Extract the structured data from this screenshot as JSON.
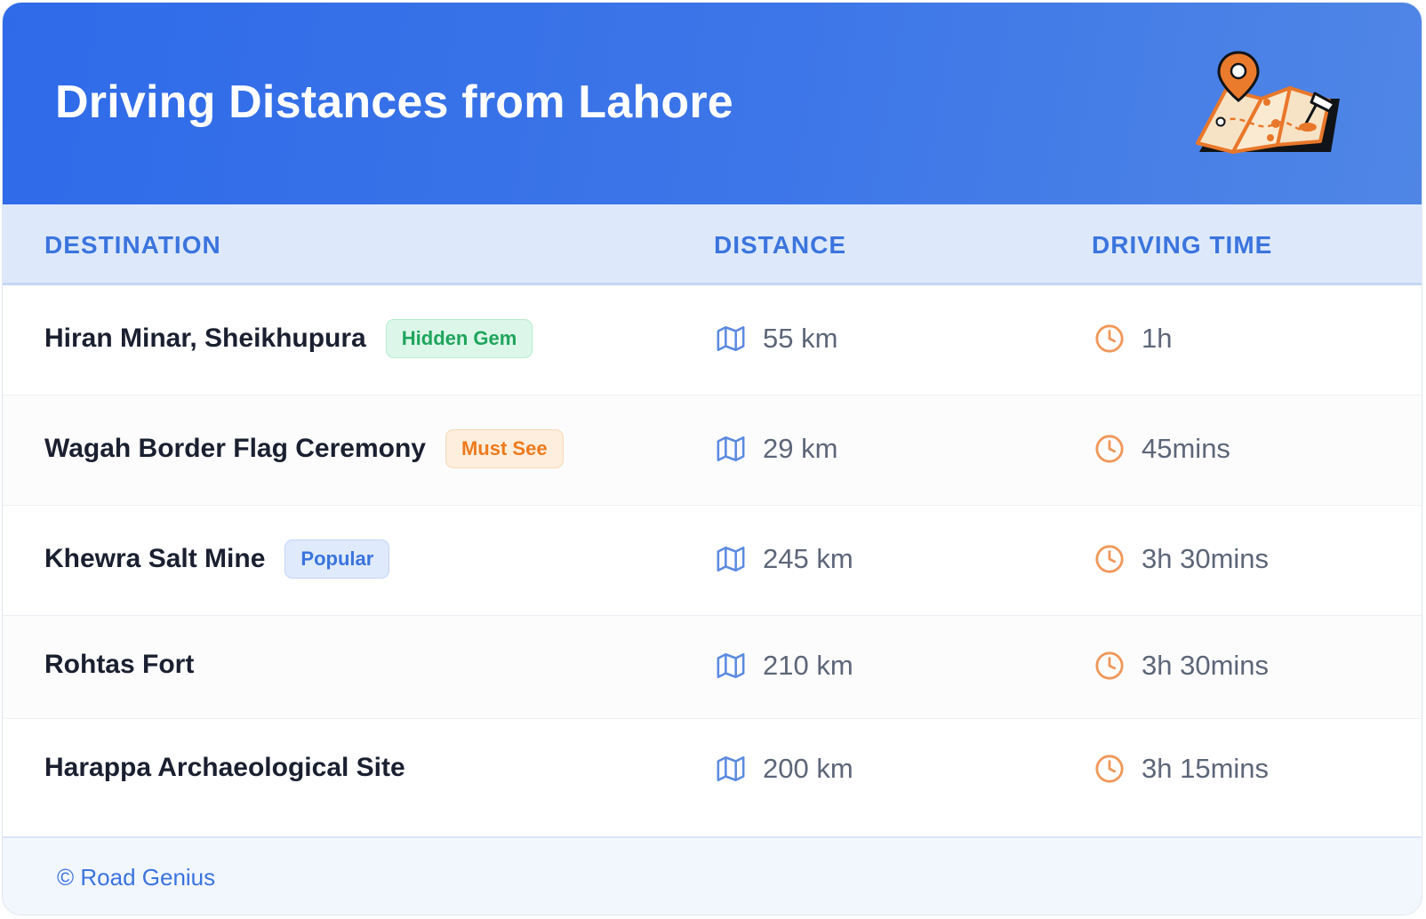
{
  "header": {
    "title": "Driving Distances from Lahore",
    "illustration_icon": "folded-map-with-pins-icon"
  },
  "columns": {
    "destination": "DESTINATION",
    "distance": "DISTANCE",
    "driving_time": "DRIVING TIME"
  },
  "rows": [
    {
      "destination": "Hiran Minar, Sheikhupura",
      "badge": "Hidden Gem",
      "badge_color": "#1fa55c",
      "distance": "55 km",
      "time": "1h"
    },
    {
      "destination": "Wagah Border Flag Ceremony",
      "badge": "Must See",
      "badge_color": "#ee7a1d",
      "distance": "29 km",
      "time": "45mins"
    },
    {
      "destination": "Khewra Salt Mine",
      "badge": "Popular",
      "badge_color": "#3b74de",
      "distance": "245 km",
      "time": "3h 30mins"
    },
    {
      "destination": "Rohtas Fort",
      "badge": "",
      "distance": "210 km",
      "time": "3h 30mins"
    },
    {
      "destination": "Harappa Archaeological Site",
      "badge": "",
      "distance": "200 km",
      "time": "3h 15mins"
    }
  ],
  "icons": {
    "distance": "map-icon",
    "time": "clock-icon"
  },
  "colors": {
    "header": "#2f6be9",
    "accent": "#3b74de",
    "map_icon": "#5b8ae0",
    "clock_icon": "#f0985a"
  },
  "footer": {
    "credit": "© Road Genius"
  }
}
